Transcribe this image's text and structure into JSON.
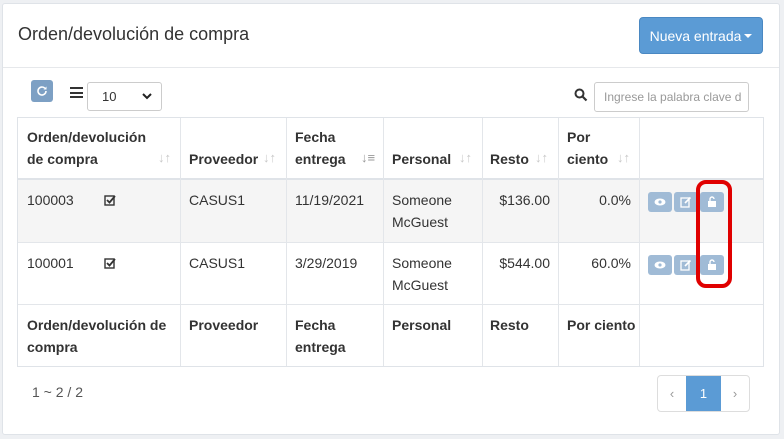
{
  "header": {
    "title": "Orden/devolución de compra",
    "new_button": "Nueva entrada"
  },
  "toolbar": {
    "page_size": "10",
    "search_placeholder": "Ingrese la palabra clave d"
  },
  "table": {
    "columns": [
      {
        "line1": "Orden/devolución",
        "line2": "de compra"
      },
      {
        "line1": "",
        "line2": "Proveedor"
      },
      {
        "line1": "Fecha",
        "line2": "entrega"
      },
      {
        "line1": "",
        "line2": "Personal"
      },
      {
        "line1": "",
        "line2": "Resto"
      },
      {
        "line1": "Por",
        "line2": "ciento"
      }
    ],
    "rows": [
      {
        "order": "100003",
        "provider": "CASUS1",
        "date": "11/19/2021",
        "staff_line1": "Someone",
        "staff_line2": "McGuest",
        "rest": "$136.00",
        "percent": "0.0%"
      },
      {
        "order": "100001",
        "provider": "CASUS1",
        "date": "3/29/2019",
        "staff_line1": "Someone",
        "staff_line2": "McGuest",
        "rest": "$544.00",
        "percent": "60.0%"
      }
    ],
    "footer": {
      "order_line1": "Orden/devolución de",
      "order_line2": "compra",
      "provider": "Proveedor",
      "date_line1": "Fecha",
      "date_line2": "entrega",
      "staff": "Personal",
      "rest": "Resto",
      "percent": "Por ciento"
    }
  },
  "pagination": {
    "info": "1 ~ 2 / 2",
    "prev": "‹",
    "current": "1",
    "next": "›"
  },
  "colors": {
    "primary": "#5b9bd5",
    "action": "#a0bbd6",
    "highlight": "#e00000"
  }
}
